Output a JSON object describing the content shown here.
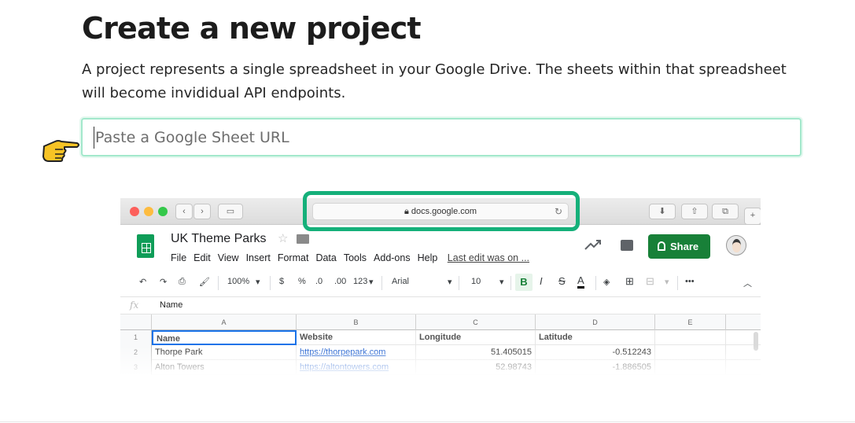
{
  "page": {
    "title": "Create a new project",
    "description": "A project represents a single spreadsheet in your Google Drive. The sheets within that spreadsheet will become invididual API endpoints.",
    "url_input": {
      "placeholder": "Paste a Google Sheet URL",
      "value": ""
    }
  },
  "colors": {
    "input_border": "#a3e8cc",
    "highlight": "#15b07a",
    "share_green": "#188038"
  },
  "screenshot": {
    "address_bar": "docs.google.com",
    "doc_title": "UK Theme Parks",
    "menu": [
      "File",
      "Edit",
      "View",
      "Insert",
      "Format",
      "Data",
      "Tools",
      "Add-ons",
      "Help"
    ],
    "last_edit": "Last edit was on ...",
    "share_label": "Share",
    "toolbar": {
      "zoom": "100%",
      "currency": "$",
      "percent": "%",
      "dec_less": ".0",
      "dec_more": ".00",
      "format": "123",
      "font": "Arial",
      "font_size": "10",
      "bold": "B",
      "italic": "I",
      "strike": "S",
      "color": "A"
    },
    "formula_label": "fx",
    "formula_value": "Name",
    "columns": [
      "A",
      "B",
      "C",
      "D",
      "E"
    ],
    "rows": [
      {
        "n": "1",
        "cells": [
          "Name",
          "Website",
          "Longitude",
          "Latitude",
          ""
        ]
      },
      {
        "n": "2",
        "cells": [
          "Thorpe Park",
          "https://thorpepark.com",
          "51.405015",
          "-0.512243",
          ""
        ]
      },
      {
        "n": "3",
        "cells": [
          "Alton Towers",
          "https://altontowers.com",
          "52.98743",
          "-1.886505",
          ""
        ]
      }
    ]
  }
}
